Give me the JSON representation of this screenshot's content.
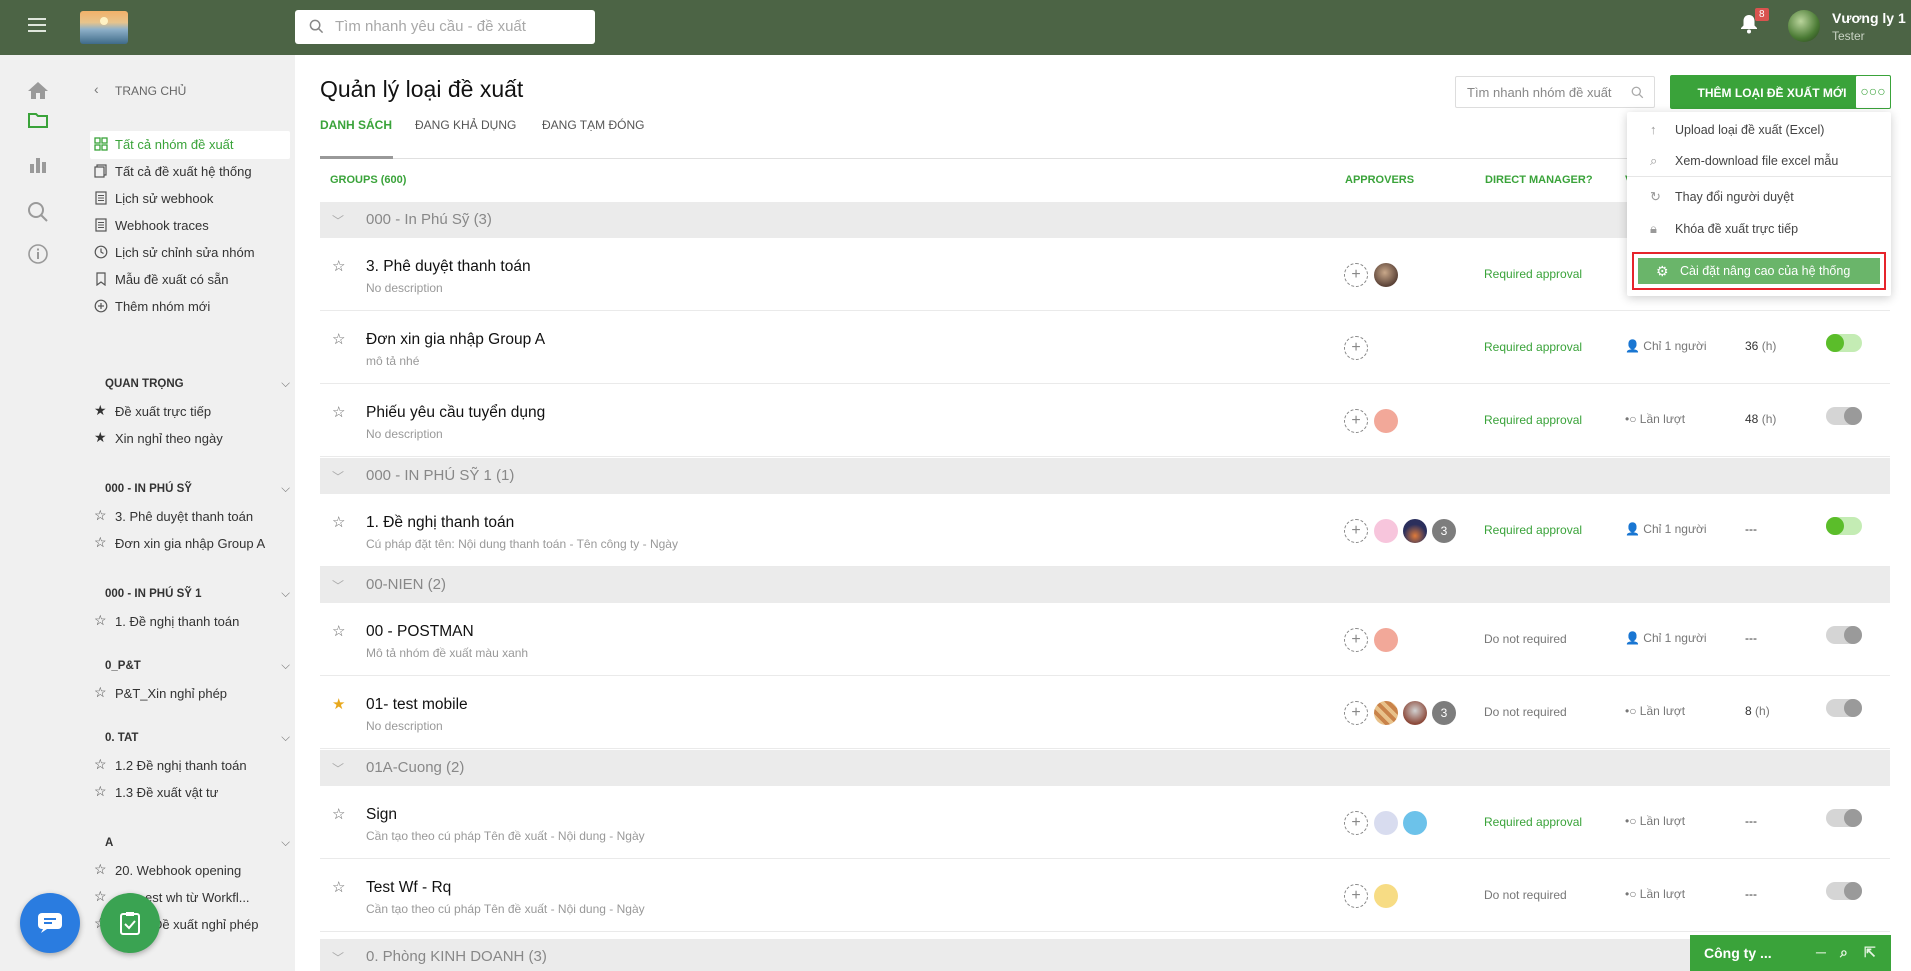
{
  "topbar": {
    "search_placeholder": "Tìm nhanh yêu cầu - đề xuất",
    "notification_count": "8",
    "user_name": "Vương ly 1",
    "user_role": "Tester"
  },
  "sidebar": {
    "back_label": "TRANG CHỦ",
    "items": [
      {
        "label": "Tất cả nhóm đề xuất",
        "icon": "grid-icon"
      },
      {
        "label": "Tất cả đề xuất hệ thống",
        "icon": "copy-icon"
      },
      {
        "label": "Lịch sử webhook",
        "icon": "document-icon"
      },
      {
        "label": "Webhook traces",
        "icon": "document-icon"
      },
      {
        "label": "Lịch sử chỉnh sửa nhóm",
        "icon": "clock-icon"
      },
      {
        "label": "Mẫu đề xuất có sẵn",
        "icon": "bookmark-icon"
      },
      {
        "label": "Thêm nhóm mới",
        "icon": "plus-circle-icon"
      }
    ],
    "sections": [
      {
        "title": "QUAN TRỌNG",
        "items": [
          "Đề xuất trực tiếp",
          "Xin nghỉ theo ngày"
        ]
      },
      {
        "title": "000 - IN PHÚ SỸ",
        "items": [
          "3. Phê duyệt thanh toán",
          "Đơn xin gia nhập Group A"
        ]
      },
      {
        "title": "000 - IN PHÚ SỸ 1",
        "items": [
          "1. Đề nghị thanh toán"
        ]
      },
      {
        "title": "0_P&T",
        "items": [
          "P&T_Xin nghỉ phép"
        ]
      },
      {
        "title": "0. TAT",
        "items": [
          "1.2 Đề nghị thanh toán",
          "1.3 Đề xuất vật tư"
        ]
      },
      {
        "title": "A",
        "items": [
          "20. Webhook opening",
          "est wh từ Workfl...",
          "- Đề xuất nghỉ phép"
        ]
      }
    ]
  },
  "main": {
    "title": "Quản lý loại đề xuất",
    "tabs": [
      "DANH SÁCH",
      "ĐANG KHẢ DỤNG",
      "ĐANG TẠM ĐÓNG"
    ],
    "group_search_placeholder": "Tìm nhanh nhóm đề xuất",
    "add_button": "THÊM LOẠI ĐỀ XUẤT MỚI",
    "more_button": "○○○",
    "columns": {
      "groups": "GROUPS (600)",
      "approvers": "APPROVERS",
      "direct_manager": "DIRECT MANAGER?",
      "partial": "V"
    },
    "group_headers": [
      "000 - In Phú Sỹ (3)",
      "000 - IN PHÚ SỸ 1 (1)",
      "00-NIEN (2)",
      "01A-Cuong (2)",
      "0. Phòng KINH DOANH (3)"
    ],
    "rows": [
      {
        "title": "3. Phê duyệt thanh toán",
        "desc": "No description",
        "dm": "Required approval",
        "flow": "",
        "hours": "",
        "unit": "",
        "on": false,
        "fav": false
      },
      {
        "title": "Đơn xin gia nhập Group A",
        "desc": "mô tả nhé",
        "dm": "Required approval",
        "flow": "Chỉ 1 người",
        "hours": "36",
        "unit": "(h)",
        "on": true,
        "fav": false
      },
      {
        "title": "Phiếu yêu cầu tuyển dụng",
        "desc": "No description",
        "dm": "Required approval",
        "flow": "Lần lượt",
        "hours": "48",
        "unit": "(h)",
        "on": false,
        "fav": false
      },
      {
        "title": "1. Đề nghị thanh toán",
        "desc": "Cú pháp đặt tên: Nội dung thanh toán - Tên công ty - Ngày",
        "dm": "Required approval",
        "flow": "Chỉ 1 người",
        "hours": "---",
        "unit": "",
        "on": true,
        "fav": false,
        "extra": "3"
      },
      {
        "title": "00 - POSTMAN",
        "desc": "Mô tả nhóm đề xuất màu xanh",
        "dm": "Do not required",
        "flow": "Chỉ 1 người",
        "hours": "---",
        "unit": "",
        "on": false,
        "fav": false
      },
      {
        "title": "01- test mobile",
        "desc": "No description",
        "dm": "Do not required",
        "flow": "Lần lượt",
        "hours": "8",
        "unit": "(h)",
        "on": false,
        "fav": true,
        "extra": "3"
      },
      {
        "title": "Sign",
        "desc": "Cần tạo theo cú pháp Tên đề xuất - Nội dung - Ngày",
        "dm": "Required approval",
        "flow": "Lần lượt",
        "hours": "---",
        "unit": "",
        "on": false,
        "fav": false
      },
      {
        "title": "Test Wf - Rq",
        "desc": "Cần tạo theo cú pháp Tên đề xuất - Nội dung - Ngày",
        "dm": "Do not required",
        "flow": "Lần lượt",
        "hours": "---",
        "unit": "",
        "on": false,
        "fav": false
      }
    ]
  },
  "dropdown": {
    "items": [
      "Upload loại đề xuất (Excel)",
      "Xem-download file excel mẫu",
      "Thay đổi người duyệt",
      "Khóa đề xuất trực tiếp"
    ],
    "highlighted": "Cài đặt nâng cao của hệ thống"
  },
  "bottom_bar": {
    "label": "Công ty ..."
  },
  "colors": {
    "topbar": "#4c6445",
    "accent": "#3aa33a",
    "highlight_border": "#e6242b"
  }
}
